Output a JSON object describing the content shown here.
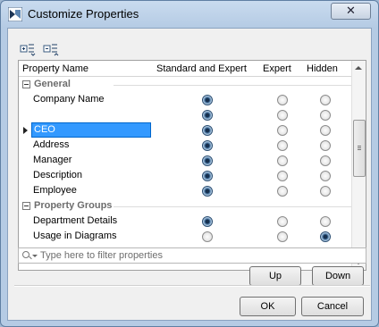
{
  "window": {
    "title": "Customize Properties",
    "close_symbol": "✕"
  },
  "toolbar": {
    "icons": [
      "expand-all-icon",
      "collapse-all-icon"
    ]
  },
  "columns": [
    "Property Name",
    "Standard and Expert",
    "Expert",
    "Hidden"
  ],
  "rows": [
    {
      "type": "group",
      "label": "General"
    },
    {
      "type": "property",
      "label": "Company Name",
      "selected": 0
    },
    {
      "type": "property",
      "label": "",
      "selected": 0
    },
    {
      "type": "property",
      "label": "CEO",
      "selected": 0,
      "editing": true
    },
    {
      "type": "property",
      "label": "Address",
      "selected": 0
    },
    {
      "type": "property",
      "label": "Manager",
      "selected": 0
    },
    {
      "type": "property",
      "label": "Description",
      "selected": 0
    },
    {
      "type": "property",
      "label": "Employee",
      "selected": 0
    },
    {
      "type": "group",
      "label": "Property Groups"
    },
    {
      "type": "property",
      "label": "Department Details",
      "selected": 0
    },
    {
      "type": "property",
      "label": "Usage in Diagrams",
      "selected": 2
    }
  ],
  "filter": {
    "placeholder": "Type here to filter properties",
    "value": ""
  },
  "buttons": {
    "up": "Up",
    "down": "Down",
    "ok": "OK",
    "cancel": "Cancel"
  }
}
